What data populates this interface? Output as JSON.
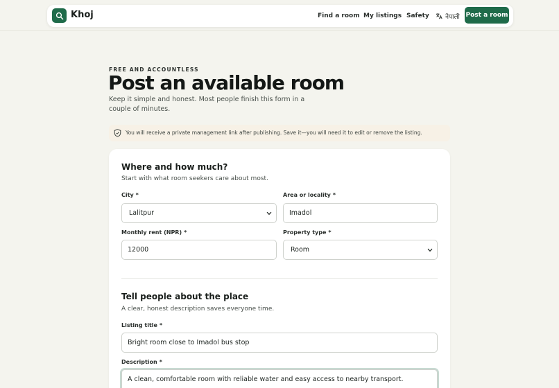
{
  "header": {
    "brand": "Khoj",
    "nav": [
      {
        "label": "Find a room"
      },
      {
        "label": "My listings"
      },
      {
        "label": "Safety"
      }
    ],
    "language": "नेपाली",
    "cta": "Post a room"
  },
  "intro": {
    "eyebrow": "FREE AND ACCOUNTLESS",
    "title": "Post an available room",
    "description": "Keep it simple and honest. Most people finish this form in a couple of minutes.",
    "notice": "You will receive a private management link after publishing. Save it—you will need it to edit or remove the listing."
  },
  "form": {
    "section1": {
      "title": "Where and how much?",
      "subtitle": "Start with what room seekers care about most.",
      "city": {
        "label": "City",
        "value": "Lalitpur"
      },
      "area": {
        "label": "Area or locality",
        "value": "Imadol"
      },
      "rent": {
        "label": "Monthly rent (NPR)",
        "value": "12000"
      },
      "property_type": {
        "label": "Property type",
        "value": "Room"
      }
    },
    "section2": {
      "title": "Tell people about the place",
      "subtitle": "A clear, honest description saves everyone time.",
      "listing_title": {
        "label": "Listing title",
        "value": "Bright room close to Imadol bus stop"
      },
      "description": {
        "label": "Description",
        "value": "A clean, comfortable room with reliable water and easy access to nearby transport."
      }
    },
    "required_marker": "*"
  },
  "colors": {
    "brand": "#1f6b4a",
    "background": "#f4f4ee",
    "notice_bg": "#f7f1e6"
  }
}
